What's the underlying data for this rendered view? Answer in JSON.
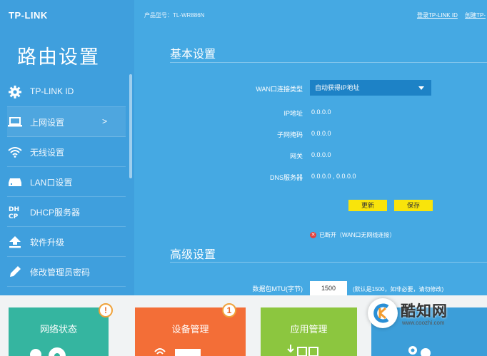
{
  "brand": "TP-LINK",
  "sidebar": {
    "title": "路由设置",
    "items": [
      {
        "label": "TP-LINK ID",
        "icon": "gear-icon"
      },
      {
        "label": "上网设置",
        "icon": "laptop-icon",
        "arrow": ">"
      },
      {
        "label": "无线设置",
        "icon": "wifi-icon"
      },
      {
        "label": "LAN口设置",
        "icon": "lan-icon"
      },
      {
        "label": "DHCP服务器",
        "icon": "dhcp-icon"
      },
      {
        "label": "软件升级",
        "icon": "upload-arrow-icon"
      },
      {
        "label": "修改管理员密码",
        "icon": "pencil-icon"
      }
    ]
  },
  "header": {
    "model": "产品型号：TL-WR886N",
    "login_link": "登录TP-LINK ID",
    "create_link": "创建TP-"
  },
  "basic": {
    "heading": "基本设置",
    "wan_type_label": "WAN口连接类型",
    "wan_type_value": "自动获得IP地址",
    "ip_label": "IP地址",
    "ip_value": "0.0.0.0",
    "mask_label": "子网掩码",
    "mask_value": "0.0.0.0",
    "gateway_label": "网关",
    "gateway_value": "0.0.0.0",
    "dns_label": "DNS服务器",
    "dns_value": "0.0.0.0 , 0.0.0.0",
    "refresh_button": "更新",
    "save_button": "保存",
    "status": "已断开（WAN口无网线连接）"
  },
  "advanced": {
    "heading": "高级设置",
    "mtu_label": "数据包MTU(字节)",
    "mtu_value": "1500",
    "mtu_hint": "(默认是1500，如非必要，请勿修改)"
  },
  "cards": [
    {
      "title": "网络状态",
      "badge": "!",
      "color": "#35b5a0"
    },
    {
      "title": "设备管理",
      "badge": "1",
      "color": "#f36e37"
    },
    {
      "title": "应用管理",
      "badge": "",
      "color": "#8cc63f"
    },
    {
      "title": "",
      "badge": "",
      "color": "#3c9ed9"
    }
  ],
  "watermark": {
    "text": "酷知网",
    "url": "www.coozhi.com"
  },
  "colors": {
    "sidebar": "#3f9fdd",
    "main": "#45a9e3",
    "button": "#f9e40b",
    "select": "#1d82c6"
  }
}
